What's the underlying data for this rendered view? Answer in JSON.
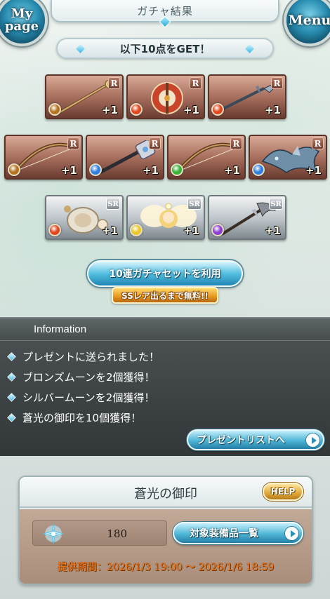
{
  "header": {
    "title": "ガチャ結果",
    "mypage_label": "My\npage",
    "menu_label": "Menu"
  },
  "banner": {
    "text": "以下10点をGET！"
  },
  "items": [
    {
      "rarity": "R",
      "element": "earth",
      "count": "+1",
      "art": "staff"
    },
    {
      "rarity": "R",
      "element": "fire",
      "count": "+1",
      "art": "axe"
    },
    {
      "rarity": "R",
      "element": "fire",
      "count": "+1",
      "art": "spear"
    },
    {
      "rarity": "R",
      "element": "earth",
      "count": "+1",
      "art": "bow"
    },
    {
      "rarity": "R",
      "element": "water",
      "count": "+1",
      "art": "mace"
    },
    {
      "rarity": "R",
      "element": "wind",
      "count": "+1",
      "art": "bow"
    },
    {
      "rarity": "R",
      "element": "water",
      "count": "+1",
      "art": "creature"
    },
    {
      "rarity": "SR",
      "element": "fire",
      "count": "+1",
      "art": "summon"
    },
    {
      "rarity": "SR",
      "element": "light",
      "count": "+1",
      "art": "angel"
    },
    {
      "rarity": "SR",
      "element": "dark",
      "count": "+1",
      "art": "halberd"
    }
  ],
  "element_colors": {
    "fire": "#e0471d",
    "water": "#2f7fe0",
    "earth": "#b5731f",
    "wind": "#38b33a",
    "light": "#e9c82a",
    "dark": "#8a3fd1"
  },
  "ten_pull": {
    "label": "10連ガチャセットを利用",
    "badge": "SSレア出るまで無料!!"
  },
  "information": {
    "title": "Information",
    "messages": [
      "プレゼントに送られました！",
      "ブロンズムーンを2個獲得！",
      "シルバームーンを2個獲得！",
      "蒼光の御印を10個獲得！"
    ],
    "present_button": "プレゼントリストへ"
  },
  "emblem": {
    "title": "蒼光の御印",
    "help_label": "HELP",
    "count": "180",
    "target_button": "対象装備品一覧",
    "period": "提供期間：2026/1/3 19:00 〜 2026/1/6 18:59"
  }
}
